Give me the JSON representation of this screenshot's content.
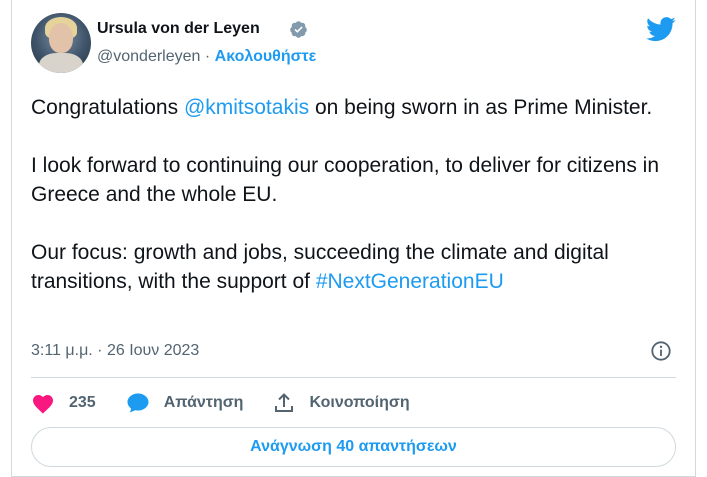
{
  "author": {
    "name": "Ursula von der Leyen",
    "handle": "@vonderleyen",
    "separator": "·",
    "follow_label": "Ακολουθήστε"
  },
  "tweet": {
    "p1_pre": "Congratulations ",
    "p1_mention": "@kmitsotakis",
    "p1_post": " on being sworn in as Prime Minister.",
    "p2": "I look forward to continuing our cooperation, to deliver for citizens in Greece and the whole EU.",
    "p3_pre": "Our focus: growth and jobs, succeeding the climate and digital transitions, with the support of ",
    "p3_hashtag": "#NextGenerationEU"
  },
  "timestamp": "3:11 μ.μ. · 26 Ιουν 2023",
  "actions": {
    "likes_count": "235",
    "reply_label": "Απάντηση",
    "share_label": "Κοινοποίηση"
  },
  "read_replies_label": "Ανάγνωση 40 απαντήσεων",
  "colors": {
    "accent": "#1d9bf0",
    "like": "#f91880",
    "text": "#0f1419",
    "muted": "#536471"
  },
  "icons": [
    "verified-badge-icon",
    "twitter-bird-icon",
    "info-icon",
    "heart-icon",
    "reply-bubble-icon",
    "share-icon"
  ]
}
